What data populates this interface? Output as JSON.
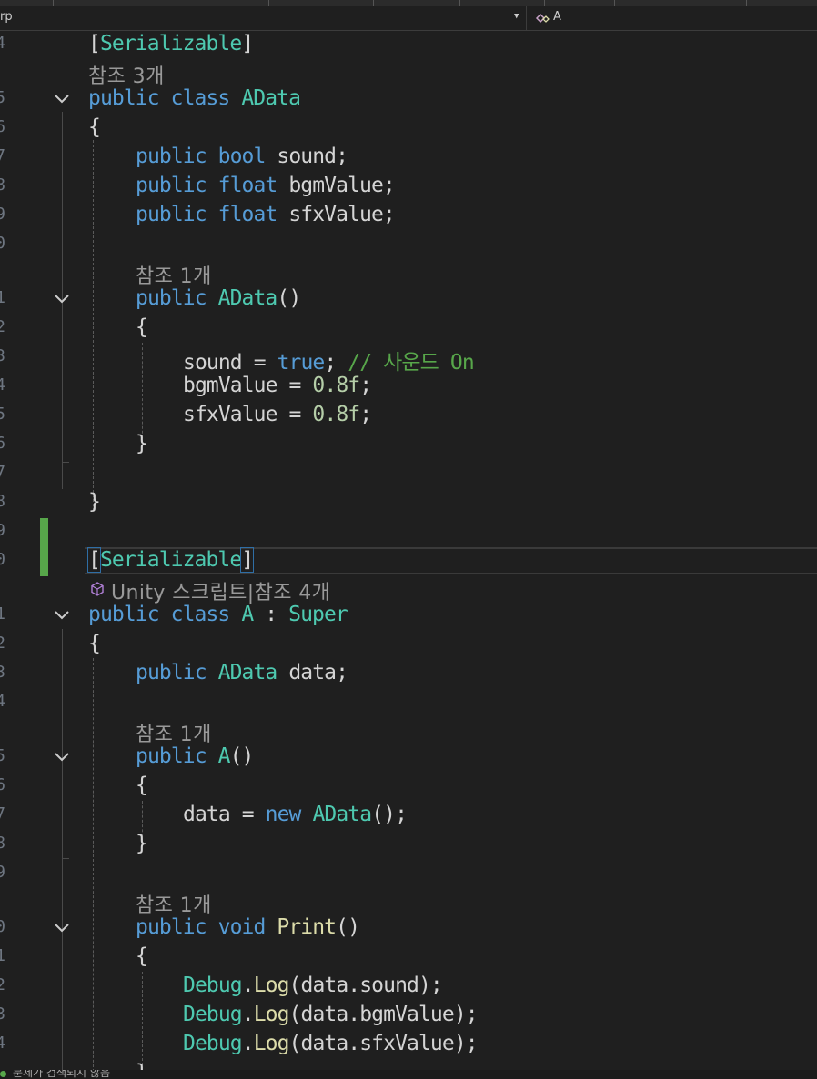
{
  "navbar": {
    "left_text": "rp",
    "right_text": "A"
  },
  "line_numbers": [
    "4",
    "",
    "5",
    "6",
    "7",
    "8",
    "9",
    "0",
    "",
    "1",
    "2",
    "3",
    "4",
    "5",
    "6",
    "7",
    "8",
    "9",
    "0",
    "",
    "1",
    "2",
    "3",
    "4",
    "",
    "5",
    "6",
    "7",
    "8",
    "9",
    "",
    "0",
    "1",
    "2",
    "3",
    "4"
  ],
  "code": {
    "attr1": "Serializable",
    "refs3": "참조 3개",
    "class1": "AData",
    "field_sound": "sound",
    "field_bgm": "bgmValue",
    "field_sfx": "sfxValue",
    "refs1": "참조 1개",
    "ctor1": "AData",
    "assign_sound": "sound",
    "val_true": "true",
    "comment1": "// 사운드 On",
    "assign_bgm": "bgmValue",
    "val_08a": "0.8f",
    "assign_sfx": "sfxValue",
    "val_08b": "0.8f",
    "attr2": "Serializable",
    "unity_lens": "Unity 스크립트|참조 4개",
    "class2": "A",
    "base": "Super",
    "field_data": "data",
    "refs1b": "참조 1개",
    "ctor2": "A",
    "assign_data": "data",
    "new_kw": "new",
    "new_type": "AData",
    "refs1c": "참조 1개",
    "method": "Print",
    "debug1": "data.sound",
    "debug2": "data.bgmValue",
    "debug3": "data.sfxValue",
    "debug_class": "Debug",
    "debug_method": "Log"
  },
  "keywords": {
    "public": "public",
    "class": "class",
    "bool": "bool",
    "float": "float",
    "void": "void"
  },
  "status": {
    "text": "문제가 검색되지 않음"
  },
  "colors": {
    "keyword": "#569cd6",
    "type": "#4ec9b0",
    "method": "#dcdcaa",
    "comment": "#57a64a",
    "number": "#b5cea8",
    "changed": "#57a64a"
  }
}
